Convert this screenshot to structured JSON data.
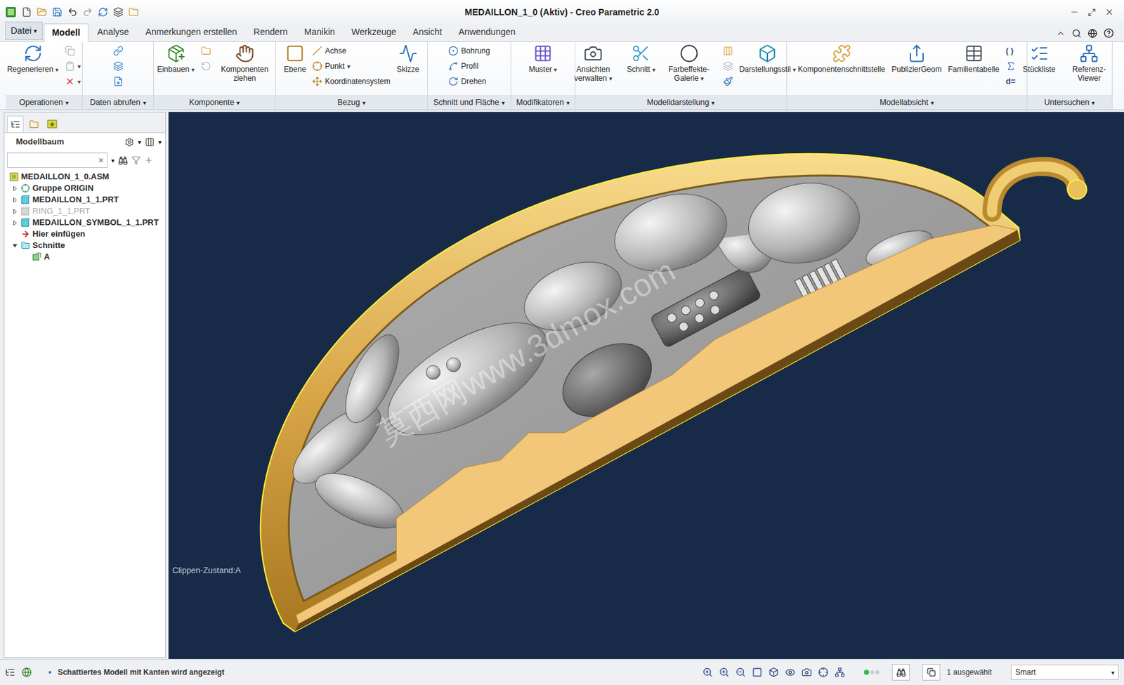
{
  "window": {
    "title": "MEDAILLON_1_0 (Aktiv) - Creo Parametric 2.0"
  },
  "dropdown_glyph": "▾",
  "menu_tabs": [
    {
      "label": "Datei",
      "selected": false,
      "dropdown": true
    },
    {
      "label": "Modell",
      "selected": true,
      "dropdown": false
    },
    {
      "label": "Analyse",
      "selected": false,
      "dropdown": false
    },
    {
      "label": "Anmerkungen erstellen",
      "selected": false,
      "dropdown": false
    },
    {
      "label": "Rendern",
      "selected": false,
      "dropdown": false
    },
    {
      "label": "Manikin",
      "selected": false,
      "dropdown": false
    },
    {
      "label": "Werkzeuge",
      "selected": false,
      "dropdown": false
    },
    {
      "label": "Ansicht",
      "selected": false,
      "dropdown": false
    },
    {
      "label": "Anwendungen",
      "selected": false,
      "dropdown": false
    }
  ],
  "ribbon_groups": [
    {
      "label": "Operationen",
      "dropdown": true,
      "columns": [
        {
          "kind": "large",
          "label": "Regenerieren",
          "dropdown": true
        },
        {
          "kind": "stack",
          "items": [
            {
              "kind": "icon",
              "dropdown": false,
              "disabled": true
            },
            {
              "kind": "icon",
              "dropdown": true,
              "disabled": true
            },
            {
              "kind": "icon",
              "dropdown": true,
              "disabled": false
            }
          ]
        }
      ]
    },
    {
      "label": "Daten abrufen",
      "dropdown": true,
      "columns": [
        {
          "kind": "stack",
          "items": [
            {
              "kind": "icon",
              "dropdown": false,
              "disabled": false
            },
            {
              "kind": "icon",
              "dropdown": false,
              "disabled": false
            },
            {
              "kind": "icon",
              "dropdown": false,
              "disabled": false
            }
          ]
        }
      ]
    },
    {
      "label": "Komponente",
      "dropdown": true,
      "columns": [
        {
          "kind": "large",
          "label": "Einbauen",
          "dropdown": true
        },
        {
          "kind": "stack",
          "items": [
            {
              "kind": "icon",
              "dropdown": false,
              "disabled": false
            },
            {
              "kind": "icon",
              "dropdown": false,
              "disabled": true
            }
          ]
        },
        {
          "kind": "large",
          "label": "Komponenten ziehen",
          "dropdown": false
        }
      ]
    },
    {
      "label": "Bezug",
      "dropdown": true,
      "columns": [
        {
          "kind": "large",
          "label": "Ebene",
          "dropdown": false
        },
        {
          "kind": "stack",
          "items": [
            {
              "kind": "labeled",
              "label": "Achse",
              "dropdown": false,
              "disabled": false
            },
            {
              "kind": "labeled",
              "label": "Punkt",
              "dropdown": true,
              "disabled": false
            },
            {
              "kind": "labeled",
              "label": "Koordinatensystem",
              "dropdown": false,
              "disabled": false
            }
          ]
        },
        {
          "kind": "large",
          "label": "Skizze",
          "dropdown": false
        }
      ]
    },
    {
      "label": "Schnitt und Fläche",
      "dropdown": true,
      "columns": [
        {
          "kind": "stack",
          "items": [
            {
              "kind": "labeled",
              "label": "Bohrung",
              "dropdown": false,
              "disabled": false
            },
            {
              "kind": "labeled",
              "label": "Profil",
              "dropdown": false,
              "disabled": false
            },
            {
              "kind": "labeled",
              "label": "Drehen",
              "dropdown": false,
              "disabled": false
            }
          ]
        }
      ]
    },
    {
      "label": "Modifikatoren",
      "dropdown": true,
      "columns": [
        {
          "kind": "large",
          "label": "Muster",
          "dropdown": true
        }
      ]
    },
    {
      "label": "Modelldarstellung",
      "dropdown": true,
      "columns": [
        {
          "kind": "large",
          "label": "Ansichten verwalten",
          "dropdown": true
        },
        {
          "kind": "large",
          "label": "Schnitt",
          "dropdown": true
        },
        {
          "kind": "large",
          "label": "Farbeffekte-Galerie",
          "dropdown": true
        },
        {
          "kind": "stack",
          "items": [
            {
              "kind": "icon",
              "dropdown": false,
              "disabled": false
            },
            {
              "kind": "icon",
              "dropdown": false,
              "disabled": true
            },
            {
              "kind": "icon",
              "dropdown": false,
              "disabled": false
            }
          ]
        },
        {
          "kind": "large",
          "label": "Darstellungsstil",
          "dropdown": true
        }
      ]
    },
    {
      "label": "Modellabsicht",
      "dropdown": true,
      "columns": [
        {
          "kind": "large",
          "label": "Komponentenschnittstelle",
          "dropdown": false
        },
        {
          "kind": "large",
          "label": "PublizierGeom",
          "dropdown": false
        },
        {
          "kind": "large",
          "label": "Familientabelle",
          "dropdown": false
        },
        {
          "kind": "stack",
          "items": [
            {
              "kind": "glyph",
              "label": "( )",
              "dropdown": false,
              "disabled": false
            },
            {
              "kind": "icon",
              "dropdown": false,
              "disabled": false
            },
            {
              "kind": "glyph",
              "label": "d=",
              "dropdown": false,
              "disabled": false
            }
          ]
        }
      ]
    },
    {
      "label": "Untersuchen",
      "dropdown": true,
      "columns": [
        {
          "kind": "large",
          "label": "Stückliste",
          "dropdown": false
        },
        {
          "kind": "large",
          "label": "Referenz-Viewer",
          "dropdown": false
        }
      ]
    }
  ],
  "model_tree": {
    "title": "Modellbaum",
    "search": {
      "clear": "×"
    },
    "items": [
      {
        "label": "MEDAILLON_1_0.ASM",
        "kind": "assembly",
        "level": 0,
        "expandable": false,
        "expanded": false,
        "disabled": false
      },
      {
        "label": "Gruppe ORIGIN",
        "kind": "group",
        "level": 1,
        "expandable": true,
        "expanded": false,
        "disabled": false
      },
      {
        "label": "MEDAILLON_1_1.PRT",
        "kind": "part",
        "level": 1,
        "expandable": true,
        "expanded": false,
        "disabled": false
      },
      {
        "label": "RING_1_1.PRT",
        "kind": "part",
        "level": 1,
        "expandable": true,
        "expanded": false,
        "disabled": true
      },
      {
        "label": "MEDAILLON_SYMBOL_1_1.PRT",
        "kind": "part",
        "level": 1,
        "expandable": true,
        "expanded": false,
        "disabled": false
      },
      {
        "label": "Hier einfügen",
        "kind": "insert",
        "level": 1,
        "expandable": false,
        "expanded": false,
        "disabled": false
      },
      {
        "label": "Schnitte",
        "kind": "folder",
        "level": 1,
        "expandable": true,
        "expanded": true,
        "disabled": false
      },
      {
        "label": "A",
        "kind": "section",
        "level": 2,
        "expandable": false,
        "expanded": false,
        "disabled": false
      }
    ]
  },
  "viewport": {
    "clip_state": "Clippen-Zustand:A",
    "watermark": "莫西网www.3dmox.com"
  },
  "status_bar": {
    "bullet": "•",
    "message": "Schattiertes Modell mit Kanten wird angezeigt",
    "selection": "1 ausgewählt",
    "filter": "Smart"
  }
}
